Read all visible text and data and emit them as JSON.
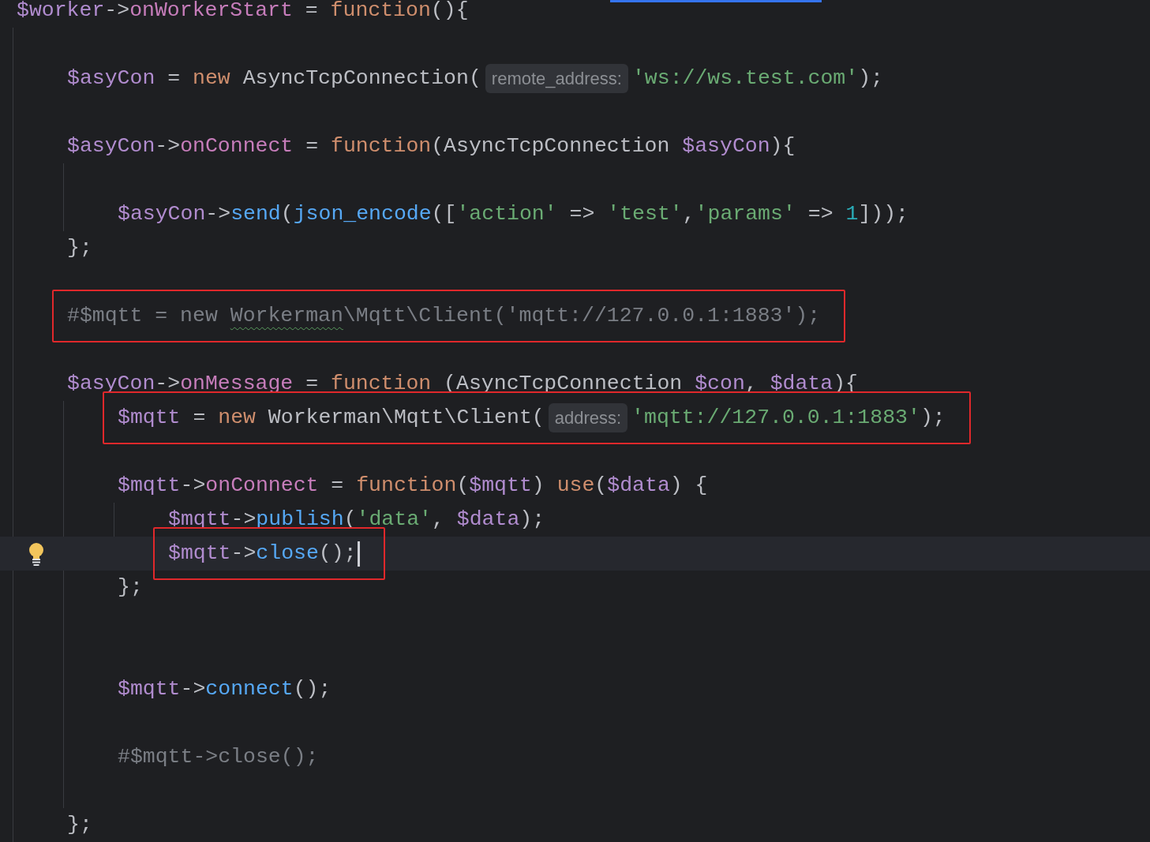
{
  "editor": {
    "lines": [
      {
        "tokens": [
          {
            "kind": "var",
            "text": "$worker"
          },
          {
            "kind": "plain",
            "text": "->"
          },
          {
            "kind": "prop",
            "text": "onWorkerStart"
          },
          {
            "kind": "plain",
            "text": " = "
          },
          {
            "kind": "kw",
            "text": "function"
          },
          {
            "kind": "plain",
            "text": "(){"
          }
        ],
        "children": [
          {
            "kind": "blank"
          },
          {
            "tokens": [
              {
                "kind": "var",
                "text": "$asyCon"
              },
              {
                "kind": "plain",
                "text": " = "
              },
              {
                "kind": "kw",
                "text": "new"
              },
              {
                "kind": "plain",
                "text": " AsyncTcpConnection("
              },
              {
                "kind": "hint",
                "text": "remote_address:"
              },
              {
                "kind": "str",
                "text": "'ws://ws.test.com'"
              },
              {
                "kind": "plain",
                "text": ");"
              }
            ]
          },
          {
            "kind": "blank"
          },
          {
            "tokens": [
              {
                "kind": "var",
                "text": "$asyCon"
              },
              {
                "kind": "plain",
                "text": "->"
              },
              {
                "kind": "prop",
                "text": "onConnect"
              },
              {
                "kind": "plain",
                "text": " = "
              },
              {
                "kind": "kw",
                "text": "function"
              },
              {
                "kind": "plain",
                "text": "(AsyncTcpConnection "
              },
              {
                "kind": "var",
                "text": "$asyCon"
              },
              {
                "kind": "plain",
                "text": "){"
              }
            ],
            "children": [
              {
                "kind": "blank"
              },
              {
                "tokens": [
                  {
                    "kind": "var",
                    "text": "$asyCon"
                  },
                  {
                    "kind": "plain",
                    "text": "->"
                  },
                  {
                    "kind": "fn",
                    "text": "send"
                  },
                  {
                    "kind": "plain",
                    "text": "("
                  },
                  {
                    "kind": "fn",
                    "text": "json_encode"
                  },
                  {
                    "kind": "plain",
                    "text": "(["
                  },
                  {
                    "kind": "str",
                    "text": "'action'"
                  },
                  {
                    "kind": "plain",
                    "text": " => "
                  },
                  {
                    "kind": "str",
                    "text": "'test'"
                  },
                  {
                    "kind": "plain",
                    "text": ","
                  },
                  {
                    "kind": "str",
                    "text": "'params'"
                  },
                  {
                    "kind": "plain",
                    "text": " => "
                  },
                  {
                    "kind": "num",
                    "text": "1"
                  },
                  {
                    "kind": "plain",
                    "text": "]));"
                  }
                ]
              }
            ]
          },
          {
            "tokens": [
              {
                "kind": "plain",
                "text": "};"
              }
            ]
          },
          {
            "kind": "blank"
          },
          {
            "highlighted": true,
            "tokens": [
              {
                "kind": "comment",
                "text": "#$mqtt = new "
              },
              {
                "kind": "comment",
                "text": "Workerman",
                "warning": true
              },
              {
                "kind": "comment",
                "text": "\\Mqtt\\Client('mqtt://127.0.0.1:1883');"
              }
            ]
          },
          {
            "kind": "blank"
          },
          {
            "tokens": [
              {
                "kind": "var",
                "text": "$asyCon"
              },
              {
                "kind": "plain",
                "text": "->"
              },
              {
                "kind": "prop",
                "text": "onMessage"
              },
              {
                "kind": "plain",
                "text": " = "
              },
              {
                "kind": "kw",
                "text": "function"
              },
              {
                "kind": "plain",
                "text": " (AsyncTcpConnection "
              },
              {
                "kind": "var",
                "text": "$con"
              },
              {
                "kind": "plain",
                "text": ", "
              },
              {
                "kind": "var",
                "text": "$data"
              },
              {
                "kind": "plain",
                "text": "){"
              }
            ],
            "children": [
              {
                "highlighted": true,
                "tokens": [
                  {
                    "kind": "var",
                    "text": "$mqtt"
                  },
                  {
                    "kind": "plain",
                    "text": " = "
                  },
                  {
                    "kind": "kw",
                    "text": "new"
                  },
                  {
                    "kind": "plain",
                    "text": " Workerman\\Mqtt\\Client("
                  },
                  {
                    "kind": "hint",
                    "text": "address:"
                  },
                  {
                    "kind": "str",
                    "text": "'mqtt://127.0.0.1:1883'"
                  },
                  {
                    "kind": "plain",
                    "text": ");"
                  }
                ]
              },
              {
                "kind": "blank"
              },
              {
                "tokens": [
                  {
                    "kind": "var",
                    "text": "$mqtt"
                  },
                  {
                    "kind": "plain",
                    "text": "->"
                  },
                  {
                    "kind": "prop",
                    "text": "onConnect"
                  },
                  {
                    "kind": "plain",
                    "text": " = "
                  },
                  {
                    "kind": "kw",
                    "text": "function"
                  },
                  {
                    "kind": "plain",
                    "text": "("
                  },
                  {
                    "kind": "var",
                    "text": "$mqtt"
                  },
                  {
                    "kind": "plain",
                    "text": ") "
                  },
                  {
                    "kind": "kw",
                    "text": "use"
                  },
                  {
                    "kind": "plain",
                    "text": "("
                  },
                  {
                    "kind": "var",
                    "text": "$data"
                  },
                  {
                    "kind": "plain",
                    "text": ") {"
                  }
                ],
                "children": [
                  {
                    "tokens": [
                      {
                        "kind": "var",
                        "text": "$mqtt"
                      },
                      {
                        "kind": "plain",
                        "text": "->"
                      },
                      {
                        "kind": "fn",
                        "text": "publish"
                      },
                      {
                        "kind": "plain",
                        "text": "("
                      },
                      {
                        "kind": "str",
                        "text": "'data'"
                      },
                      {
                        "kind": "plain",
                        "text": ", "
                      },
                      {
                        "kind": "var",
                        "text": "$data"
                      },
                      {
                        "kind": "plain",
                        "text": ");"
                      }
                    ]
                  },
                  {
                    "highlighted": true,
                    "current": true,
                    "caret": true,
                    "bulb": true,
                    "tokens": [
                      {
                        "kind": "var",
                        "text": "$mqtt"
                      },
                      {
                        "kind": "plain",
                        "text": "->"
                      },
                      {
                        "kind": "fn",
                        "text": "close"
                      },
                      {
                        "kind": "plain",
                        "text": "();"
                      }
                    ]
                  }
                ]
              },
              {
                "tokens": [
                  {
                    "kind": "plain",
                    "text": "};"
                  }
                ]
              },
              {
                "kind": "blank"
              },
              {
                "kind": "blank"
              },
              {
                "tokens": [
                  {
                    "kind": "var",
                    "text": "$mqtt"
                  },
                  {
                    "kind": "plain",
                    "text": "->"
                  },
                  {
                    "kind": "fn",
                    "text": "connect"
                  },
                  {
                    "kind": "plain",
                    "text": "();"
                  }
                ]
              },
              {
                "kind": "blank"
              },
              {
                "tokens": [
                  {
                    "kind": "comment",
                    "text": "#$mqtt->close();"
                  }
                ]
              },
              {
                "kind": "blank"
              }
            ]
          },
          {
            "tokens": [
              {
                "kind": "plain",
                "text": "};"
              }
            ]
          }
        ]
      }
    ]
  }
}
